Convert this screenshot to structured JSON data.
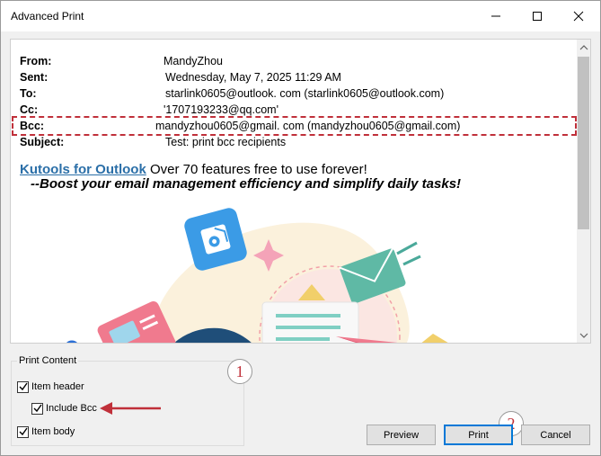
{
  "window": {
    "title": "Advanced Print"
  },
  "titlebar": {
    "minimize_icon": "minimize-icon",
    "maximize_icon": "maximize-icon",
    "close_icon": "close-icon"
  },
  "message": {
    "from_label": "From:",
    "from_value": "MandyZhou",
    "sent_label": "Sent:",
    "sent_value": "Wednesday, May 7, 2025 11:29 AM",
    "to_label": "To:",
    "to_value": "starlink0605@outlook. com (starlink0605@outlook.com)",
    "cc_label": "Cc:",
    "cc_value": "'1707193233@qq.com'",
    "bcc_label": "Bcc:",
    "bcc_value": "mandyzhou0605@gmail. com (mandyzhou0605@gmail.com)",
    "subject_label": "Subject:",
    "subject_value": "Test: print bcc recipients"
  },
  "promo": {
    "link_text": "Kutools for Outlook",
    "text": " Over 70 features free to use forever!",
    "tagline": "--Boost your email management efficiency and simplify daily tasks!"
  },
  "print_content": {
    "title": "Print Content",
    "item_header": {
      "label": "Item header",
      "checked": true
    },
    "include_bcc": {
      "label": "Include Bcc",
      "checked": true
    },
    "item_body": {
      "label": "Item body",
      "checked": true
    }
  },
  "annotations": {
    "step1": "1",
    "step2": "2"
  },
  "buttons": {
    "preview": "Preview",
    "print": "Print",
    "cancel": "Cancel"
  },
  "colors": {
    "accent": "#0078d7",
    "annotation_red": "#c0303a",
    "link": "#2b6fa8"
  }
}
